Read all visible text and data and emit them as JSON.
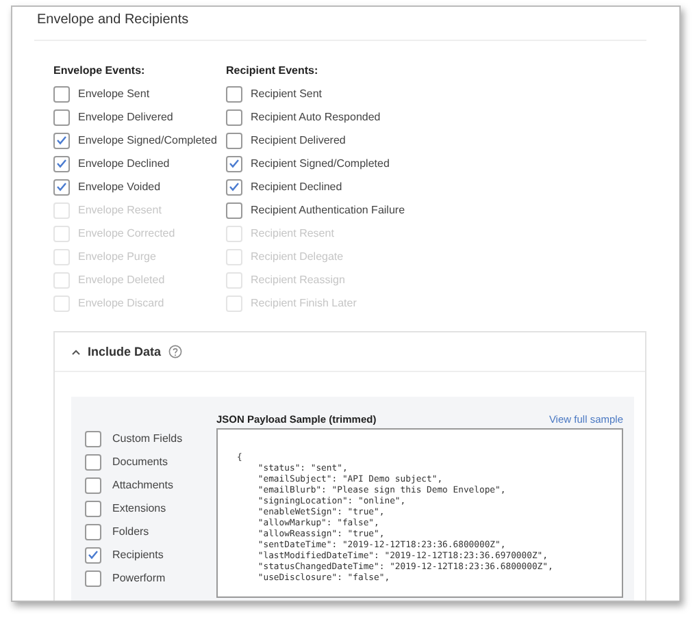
{
  "section_title": "Envelope and Recipients",
  "envelope_events": {
    "heading": "Envelope Events:",
    "items": [
      {
        "label": "Envelope Sent",
        "checked": false,
        "disabled": false
      },
      {
        "label": "Envelope Delivered",
        "checked": false,
        "disabled": false
      },
      {
        "label": "Envelope Signed/Completed",
        "checked": true,
        "disabled": false
      },
      {
        "label": "Envelope Declined",
        "checked": true,
        "disabled": false
      },
      {
        "label": "Envelope Voided",
        "checked": true,
        "disabled": false
      },
      {
        "label": "Envelope Resent",
        "checked": false,
        "disabled": true
      },
      {
        "label": "Envelope Corrected",
        "checked": false,
        "disabled": true
      },
      {
        "label": "Envelope Purge",
        "checked": false,
        "disabled": true
      },
      {
        "label": "Envelope Deleted",
        "checked": false,
        "disabled": true
      },
      {
        "label": "Envelope Discard",
        "checked": false,
        "disabled": true
      }
    ]
  },
  "recipient_events": {
    "heading": "Recipient Events:",
    "items": [
      {
        "label": "Recipient Sent",
        "checked": false,
        "disabled": false
      },
      {
        "label": "Recipient Auto Responded",
        "checked": false,
        "disabled": false
      },
      {
        "label": "Recipient Delivered",
        "checked": false,
        "disabled": false
      },
      {
        "label": "Recipient Signed/Completed",
        "checked": true,
        "disabled": false
      },
      {
        "label": "Recipient Declined",
        "checked": true,
        "disabled": false
      },
      {
        "label": "Recipient Authentication Failure",
        "checked": false,
        "disabled": false
      },
      {
        "label": "Recipient Resent",
        "checked": false,
        "disabled": true
      },
      {
        "label": "Recipient Delegate",
        "checked": false,
        "disabled": true
      },
      {
        "label": "Recipient Reassign",
        "checked": false,
        "disabled": true
      },
      {
        "label": "Recipient Finish Later",
        "checked": false,
        "disabled": true
      }
    ]
  },
  "include_data": {
    "title": "Include Data",
    "expanded": true,
    "options": [
      {
        "label": "Custom Fields",
        "checked": false
      },
      {
        "label": "Documents",
        "checked": false
      },
      {
        "label": "Attachments",
        "checked": false
      },
      {
        "label": "Extensions",
        "checked": false
      },
      {
        "label": "Folders",
        "checked": false
      },
      {
        "label": "Recipients",
        "checked": true
      },
      {
        "label": "Powerform",
        "checked": false
      }
    ],
    "payload": {
      "label": "JSON Payload Sample (trimmed)",
      "link": "View full sample",
      "lines": [
        "{",
        "    \"status\": \"sent\",",
        "    \"emailSubject\": \"API Demo subject\",",
        "    \"emailBlurb\": \"Please sign this Demo Envelope\",",
        "    \"signingLocation\": \"online\",",
        "    \"enableWetSign\": \"true\",",
        "    \"allowMarkup\": \"false\",",
        "    \"allowReassign\": \"true\",",
        "    \"sentDateTime\": \"2019-12-12T18:23:36.6800000Z\",",
        "    \"lastModifiedDateTime\": \"2019-12-12T18:23:36.6970000Z\",",
        "    \"statusChangedDateTime\": \"2019-12-12T18:23:36.6800000Z\",",
        "    \"useDisclosure\": \"false\","
      ]
    }
  }
}
